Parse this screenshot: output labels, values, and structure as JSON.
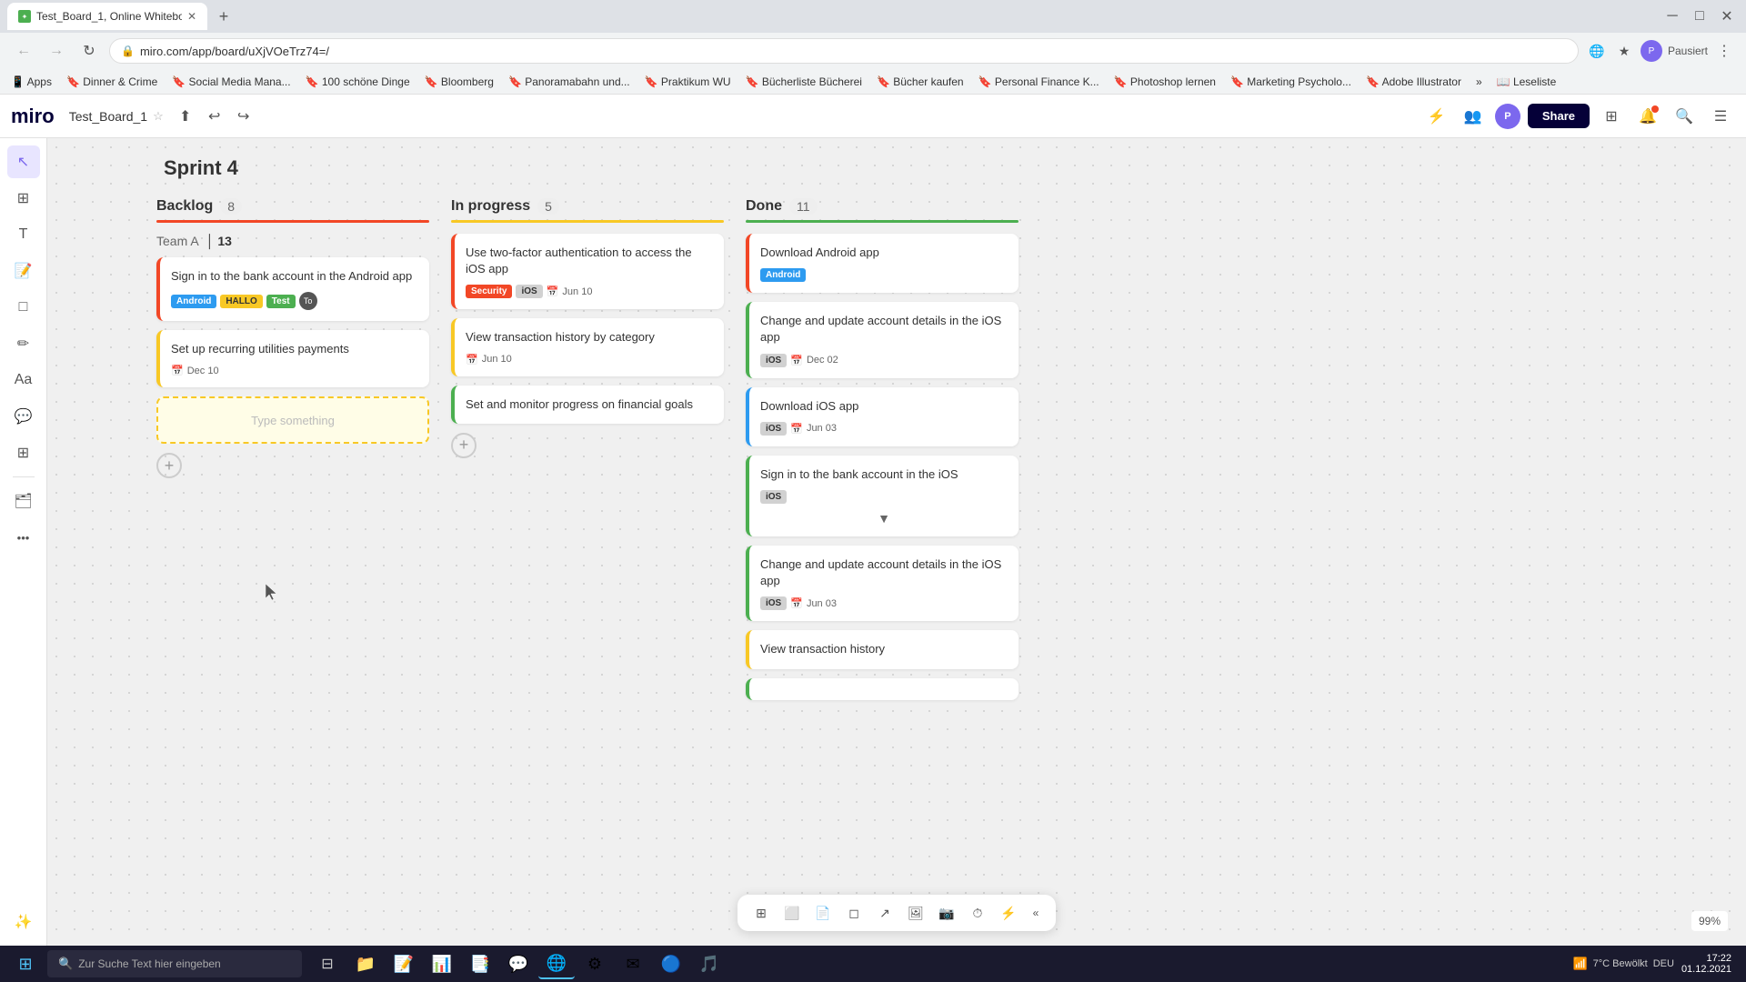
{
  "browser": {
    "tab_title": "Test_Board_1, Online Whiteboar...",
    "url": "miro.com/app/board/uXjVOeTrz74=/",
    "bookmarks": [
      "Apps",
      "Dinner & Crime",
      "Social Media Mana...",
      "100 schöne Dinge",
      "Bloomberg",
      "Panoramabahn und...",
      "Praktikum WU",
      "Bücherliste Bücherei",
      "Bücher kaufen",
      "Personal Finance K...",
      "Photoshop lernen",
      "Marketing Psycholo...",
      "Adobe Illustrator",
      "Leseliste"
    ]
  },
  "miro": {
    "logo": "miro",
    "board_name": "Test_Board_1",
    "share_label": "Share",
    "paused_label": "Pausiert",
    "date": "01.12.2021",
    "zoom": "99%",
    "time": "17:22"
  },
  "board": {
    "sprint_title": "Sprint 4",
    "columns": [
      {
        "title": "Backlog",
        "count": "8",
        "type": "backlog",
        "team_label": "Team A",
        "team_count": "13",
        "cards": [
          {
            "title": "Sign in to the bank account in the Android app",
            "border": "red",
            "tags": [
              {
                "label": "Android",
                "class": "tag-android"
              },
              {
                "label": "HALLO",
                "class": "tag-hallo"
              },
              {
                "label": "Test",
                "class": "tag-test"
              }
            ],
            "has_avatar": true,
            "avatar_label": "To",
            "date": null
          },
          {
            "title": "Set up recurring utilities payments",
            "border": "yellow",
            "tags": [],
            "has_avatar": false,
            "date": "Dec 10"
          }
        ],
        "type_placeholder": "Type something"
      },
      {
        "title": "In progress",
        "count": "5",
        "type": "inprogress",
        "cards": [
          {
            "title": "Use two-factor authentication to access the iOS app",
            "border": "red",
            "tags": [
              {
                "label": "Security",
                "class": "tag-security"
              },
              {
                "label": "iOS",
                "class": "tag-ios"
              }
            ],
            "date": "Jun 10"
          },
          {
            "title": "View transaction history by category",
            "border": "yellow",
            "tags": [],
            "date": "Jun 10"
          },
          {
            "title": "Set and monitor progress on financial goals",
            "border": "green",
            "tags": [],
            "date": null
          }
        ]
      },
      {
        "title": "Done",
        "count": "11",
        "type": "done",
        "cards": [
          {
            "title": "Download Android app",
            "border": "red",
            "tags": [
              {
                "label": "Android",
                "class": "tag-android-done"
              }
            ],
            "date": null
          },
          {
            "title": "Change and update account details in the iOS app",
            "border": "green",
            "tags": [
              {
                "label": "iOS",
                "class": "tag-ios"
              }
            ],
            "date": "Dec 02"
          },
          {
            "title": "Download iOS app",
            "border": "blue",
            "tags": [
              {
                "label": "iOS",
                "class": "tag-ios"
              }
            ],
            "date": "Jun 03"
          },
          {
            "title": "Sign in to the bank account in the iOS",
            "border": "green",
            "tags": [
              {
                "label": "iOS",
                "class": "tag-ios"
              }
            ],
            "date": null,
            "collapsed": true
          },
          {
            "title": "Change and update account details in the iOS app",
            "border": "green",
            "tags": [
              {
                "label": "iOS",
                "class": "tag-ios"
              }
            ],
            "date": "Jun 03"
          },
          {
            "title": "View transaction history",
            "border": "yellow",
            "tags": [],
            "date": null
          }
        ]
      }
    ]
  },
  "taskbar": {
    "search_placeholder": "Zur Suche Text hier eingeben",
    "time": "17:22",
    "date": "01.12.2021",
    "weather": "7°C Bewölkt",
    "lang": "DEU"
  }
}
